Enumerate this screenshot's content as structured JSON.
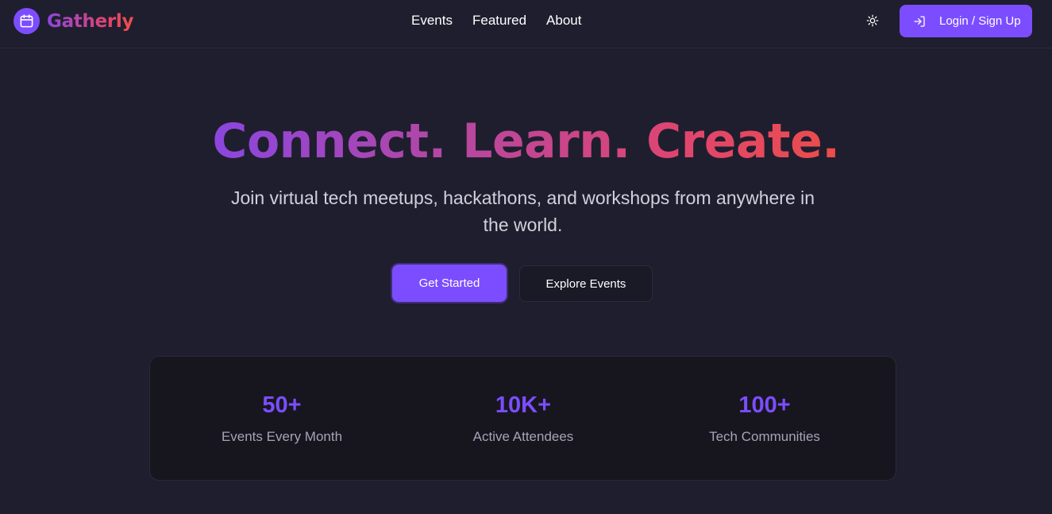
{
  "nav": {
    "brand": "Gatherly",
    "links": [
      "Events",
      "Featured",
      "About"
    ],
    "login_label": "Login / Sign Up",
    "icons": {
      "logo": "calendar-icon",
      "theme": "sun-icon",
      "login": "login-arrow-icon"
    }
  },
  "hero": {
    "title": "Connect. Learn. Create.",
    "subtitle_line1": "Join virtual tech meetups, hackathons, and workshops from anywhere in",
    "subtitle_line2": "the world.",
    "primary_cta": "Get Started",
    "secondary_cta": "Explore Events"
  },
  "stats": [
    {
      "value": "50+",
      "label": "Events Every Month"
    },
    {
      "value": "10K+",
      "label": "Active Attendees"
    },
    {
      "value": "100+",
      "label": "Tech Communities"
    }
  ],
  "colors": {
    "background": "#1f1e2e",
    "accent": "#7c4dff",
    "gradient_start": "#8b46df",
    "gradient_end": "#ee5048",
    "stats_panel": "#17161f"
  }
}
